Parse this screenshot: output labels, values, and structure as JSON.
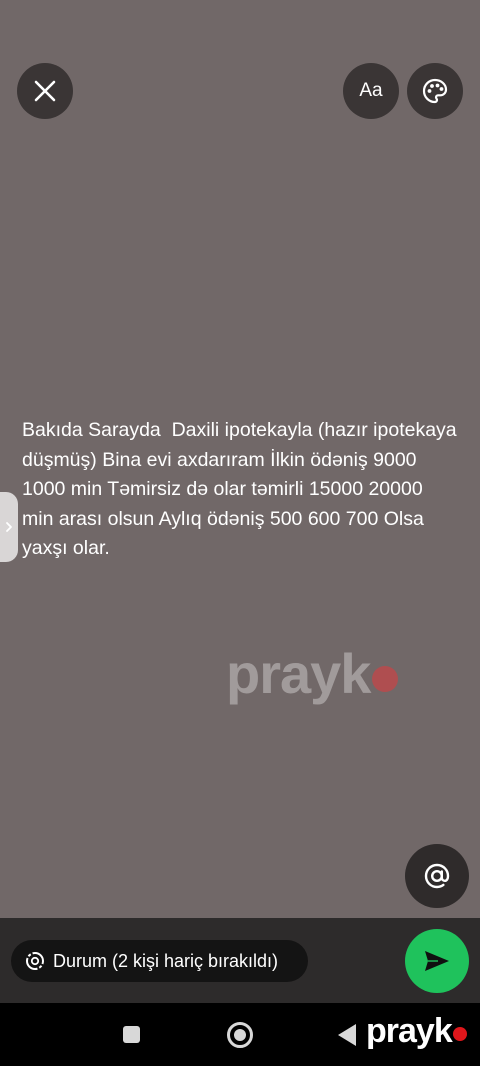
{
  "toolbar": {
    "close_icon": "close-icon",
    "font_label": "Aa",
    "palette_icon": "palette-icon"
  },
  "status": {
    "text": "Bakıda Sarayda  Daxili ipotekayla (hazır ipotekaya düşmüş) Bina evi axdarıram İlkin ödəniş 9000 1000 min Təmirsiz də olar təmirli 15000 20000 min arası olsun Aylıq ödəniş 500 600 700 Olsa yaxşı olar.",
    "background_color": "#716868"
  },
  "watermark": {
    "text": "prayk"
  },
  "mention": {
    "icon": "at-sign-icon"
  },
  "composer": {
    "audience_label": "Durum (2 kişi hariç bırakıldı)",
    "audience_icon": "status-ring-icon",
    "send_icon": "send-icon",
    "send_color": "#1fc25c"
  },
  "navbar": {
    "recents_icon": "recents-icon",
    "home_icon": "home-icon",
    "back_icon": "back-icon",
    "brand_text": "prayk",
    "brand_dot_color": "#e0161b"
  }
}
